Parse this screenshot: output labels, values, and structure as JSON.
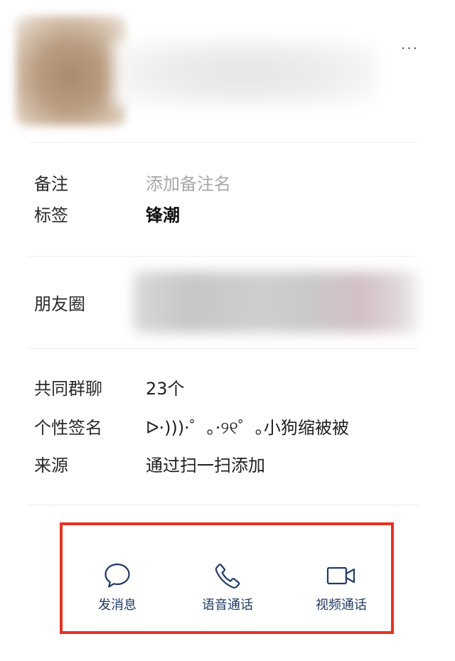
{
  "header": {
    "more_label": "···"
  },
  "profile": {
    "remark": {
      "label": "备注",
      "value": "添加备注名"
    },
    "tag": {
      "label": "标签",
      "value": "锋潮"
    },
    "moments": {
      "label": "朋友圈"
    },
    "groups": {
      "label": "共同群聊",
      "value": "23个"
    },
    "signature": {
      "label": "个性签名",
      "value": "ᐅ·)))·゜｡·୨୧゜｡小狗缩被被"
    },
    "source": {
      "label": "来源",
      "value": "通过扫一扫添加"
    }
  },
  "actions": {
    "message": "发消息",
    "voice_call": "语音通话",
    "video_call": "视频通话"
  },
  "colors": {
    "highlight_border": "#e63323",
    "action_text": "#1e3a68"
  }
}
